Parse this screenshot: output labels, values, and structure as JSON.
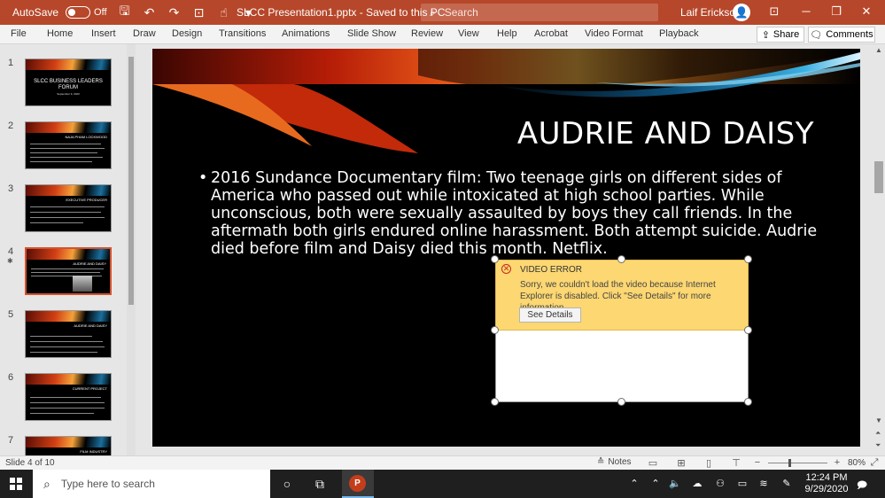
{
  "titlebar": {
    "autosave_label": "AutoSave",
    "autosave_state": "Off",
    "document_title": "SLCC Presentation1.pptx  -  Saved to this PC",
    "search_placeholder": "Search",
    "user_name": "Laif Erickson"
  },
  "ribbon": {
    "tabs": [
      "File",
      "Home",
      "Insert",
      "Draw",
      "Design",
      "Transitions",
      "Animations",
      "Slide Show",
      "Review",
      "View",
      "Help",
      "Acrobat",
      "Video Format",
      "Playback"
    ],
    "share_label": "Share",
    "comments_label": "Comments"
  },
  "thumbnails": [
    {
      "number": "1",
      "title": "SLCC BUSINESS LEADERS FORUM",
      "subtitle": "September 9, 2020"
    },
    {
      "number": "2",
      "title": "NAJA PHAM LOCKWOOD"
    },
    {
      "number": "3",
      "title": "EXECUTIVE PRODUCER"
    },
    {
      "number": "4",
      "title": "AUDRIE AND DAISY"
    },
    {
      "number": "5",
      "title": "AUDRIE AND DAISY"
    },
    {
      "number": "6",
      "title": "CURRENT PROJECT"
    },
    {
      "number": "7",
      "title": "FILM INDUSTRY"
    }
  ],
  "slide": {
    "title": "AUDRIE AND DAISY",
    "bullet": "2016 Sundance Documentary film: Two teenage girls on different sides of America who passed out while intoxicated at high school parties. While unconscious, both were sexually assaulted by boys they call friends. In the aftermath both girls endured online harassment. Both attempt suicide. Audrie died before film and Daisy died this month. Netflix."
  },
  "video_error": {
    "title": "VIDEO ERROR",
    "message": "Sorry, we couldn't load the video because Internet Explorer is disabled. Click \"See Details\" for more information.",
    "button_label": "See Details"
  },
  "statusbar": {
    "slide_indicator": "Slide 4 of 10",
    "notes_label": "Notes",
    "zoom_minus": "−",
    "zoom_plus": "+",
    "zoom_level": "80%"
  },
  "taskbar": {
    "search_placeholder": "Type here to search",
    "time": "12:24 PM",
    "date": "9/29/2020"
  },
  "colors": {
    "titlebar": "#b7472a",
    "slide_background": "#000000",
    "error_background": "#fcd772",
    "active_thumbnail_border": "#d35230"
  }
}
